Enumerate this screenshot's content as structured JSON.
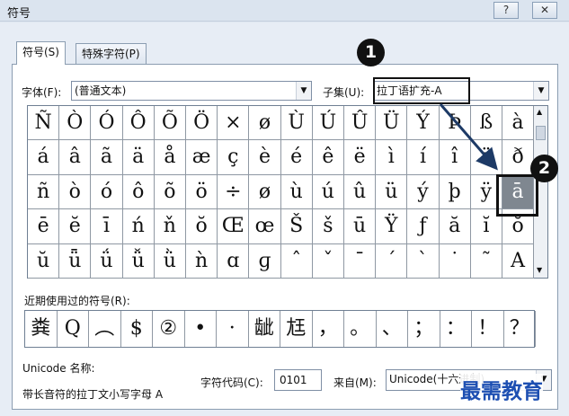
{
  "dialog": {
    "title": "符号",
    "help_label": "?",
    "close_label": "✕"
  },
  "tabs": [
    {
      "label": "符号(S)"
    },
    {
      "label": "特殊字符(P)"
    }
  ],
  "font": {
    "label": "字体(F):",
    "value": "(普通文本)"
  },
  "subset": {
    "label": "子集(U):",
    "value": "拉丁语扩充-A"
  },
  "symbols": [
    [
      "Ñ",
      "Ò",
      "Ó",
      "Ô",
      "Õ",
      "Ö",
      "×",
      "ø",
      "Ù",
      "Ú",
      "Û",
      "Ü",
      "Ý",
      "Þ",
      "ß",
      "à"
    ],
    [
      "á",
      "â",
      "ã",
      "ä",
      "å",
      "æ",
      "ç",
      "è",
      "é",
      "ê",
      "ë",
      "ì",
      "í",
      "î",
      "ï",
      "ð"
    ],
    [
      "ñ",
      "ò",
      "ó",
      "ô",
      "õ",
      "ö",
      "÷",
      "ø",
      "ù",
      "ú",
      "û",
      "ü",
      "ý",
      "þ",
      "ÿ",
      "ā"
    ],
    [
      "ē",
      "ĕ",
      "ī",
      "ń",
      "ň",
      "ŏ",
      "Œ",
      "œ",
      "Š",
      "š",
      "ū",
      "Ÿ",
      "ƒ",
      "ă",
      "ĭ",
      "ŏ"
    ],
    [
      "ŭ",
      "ǖ",
      "ǘ",
      "ǚ",
      "ǜ",
      "ǹ",
      "ɑ",
      "ɡ",
      "ˆ",
      "ˇ",
      "ˉ",
      "ˊ",
      "ˋ",
      "˙",
      "˜",
      "A"
    ]
  ],
  "selected_symbol": "ā",
  "recent": {
    "label": "近期使用过的符号(R):",
    "items": [
      "粪",
      "Q",
      "︵",
      "$",
      "②",
      "•",
      "·",
      "龇",
      "尪",
      "，",
      "。",
      "、",
      "；",
      "：",
      "！",
      "？"
    ]
  },
  "unicode_name": {
    "label": "Unicode 名称:",
    "value": "带长音符的拉丁文小写字母 A"
  },
  "char_code": {
    "label": "字符代码(C):",
    "value": "0101"
  },
  "from": {
    "label": "来自(M):",
    "value": "Unicode(十六进制)"
  },
  "callouts": [
    "1",
    "2"
  ],
  "watermark": "最需教育",
  "colors": {
    "selected_bg": "#7f8790",
    "arrow": "#1d3a66"
  }
}
